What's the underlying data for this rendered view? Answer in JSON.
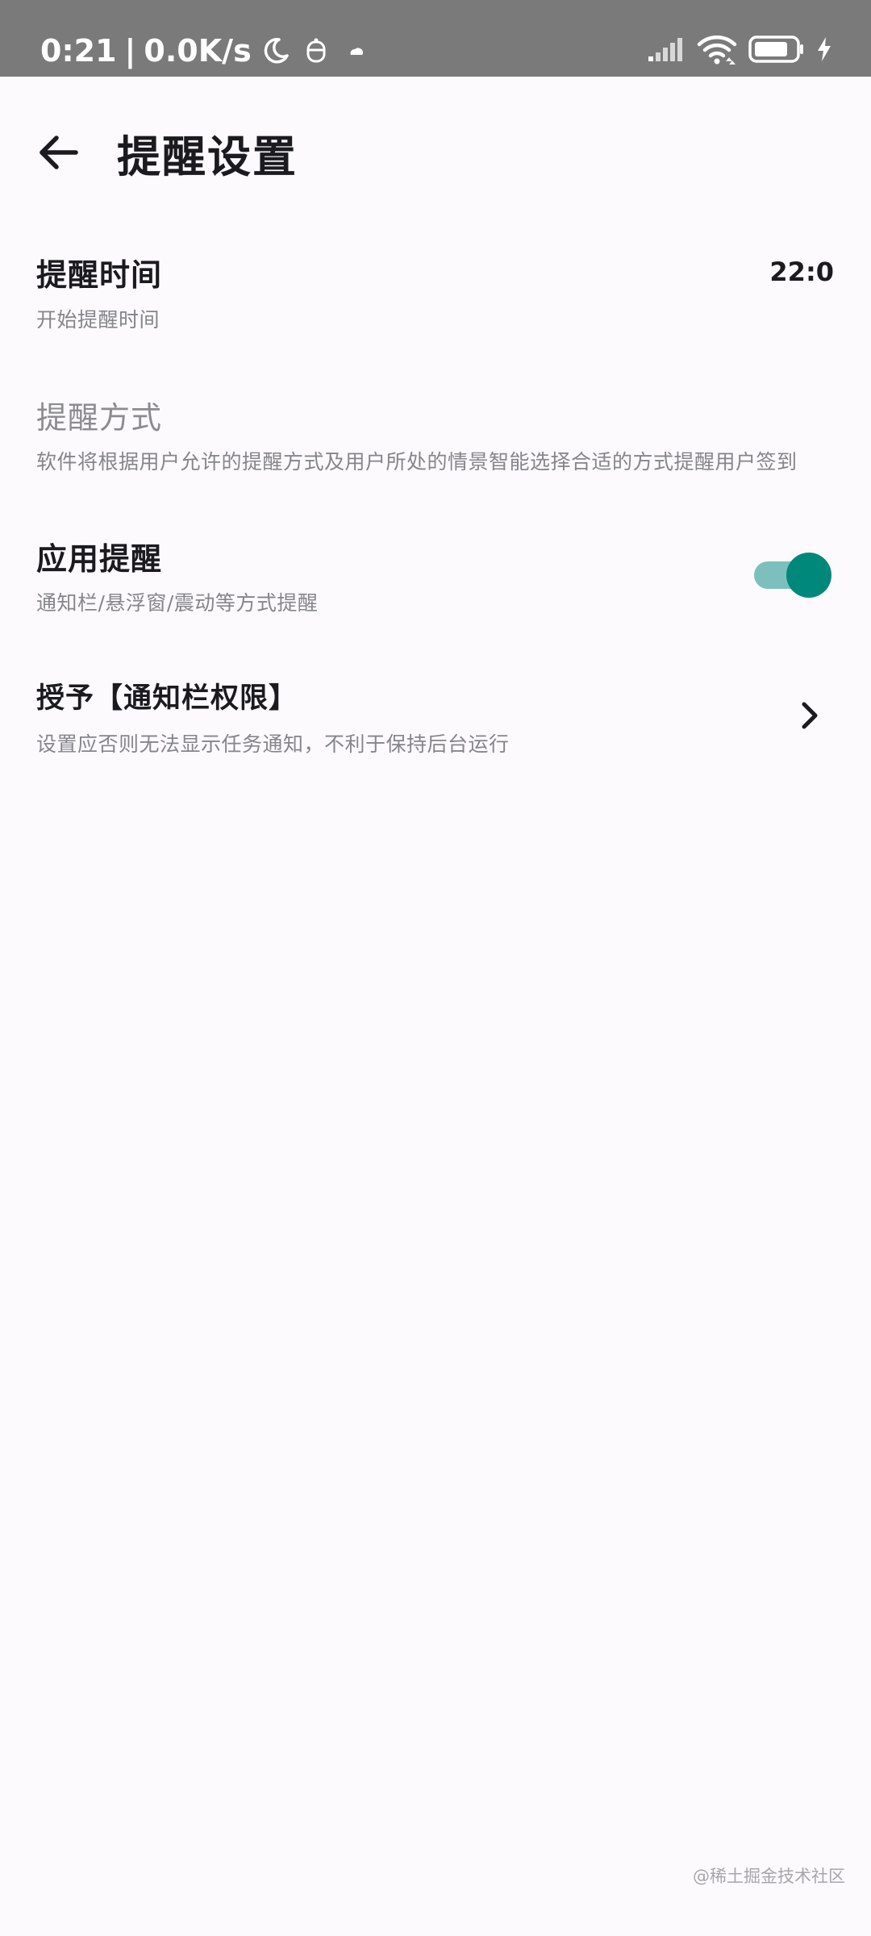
{
  "status_bar": {
    "time": "0:21",
    "separator": "|",
    "net_speed": "0.0K/s",
    "icons": [
      "moon-icon",
      "robot-icon",
      "cloud-icon",
      "signal-icon",
      "wifi-icon",
      "battery-icon",
      "charging-bolt-icon"
    ]
  },
  "header": {
    "back_icon": "arrow-left-icon",
    "title": "提醒设置"
  },
  "settings": {
    "remind_time": {
      "title": "提醒时间",
      "subtitle": "开始提醒时间",
      "value": "22:0"
    },
    "remind_method": {
      "title": "提醒方式",
      "subtitle": "软件将根据用户允许的提醒方式及用户所处的情景智能选择合适的方式提醒用户签到"
    },
    "app_reminder": {
      "title": "应用提醒",
      "subtitle": "通知栏/悬浮窗/震动等方式提醒",
      "enabled": true
    },
    "grant_permission": {
      "title": "授予【通知栏权限】",
      "subtitle": "设置应否则无法显示任务通知，不利于保持后台运行",
      "icon": "chevron-right-icon"
    }
  },
  "watermark": "@稀土掘金技术社区",
  "colors": {
    "status_bar": "#7a7a7a",
    "background": "#fcfafd",
    "switch_thumb": "#00897b",
    "switch_track": "#7dbfbc"
  }
}
